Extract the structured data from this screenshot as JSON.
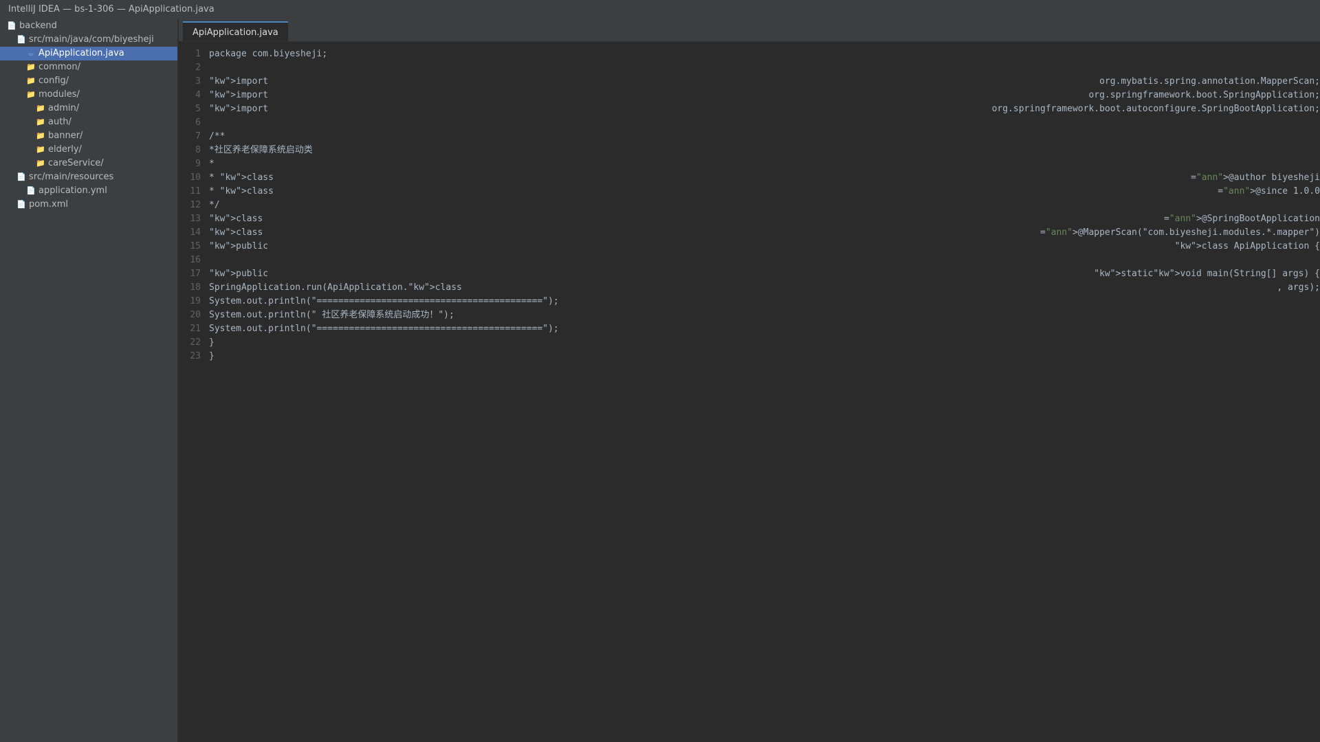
{
  "window": {
    "title": "IntelliJ IDEA — bs-1-306 — ApiApplication.java"
  },
  "sidebar": {
    "items": [
      {
        "label": "backend",
        "icon": "file-icon",
        "indent": 0
      },
      {
        "label": "src/main/java/com/biyesheji",
        "icon": "file-icon",
        "indent": 1
      },
      {
        "label": "ApiApplication.java",
        "icon": "java-file-icon",
        "indent": 2,
        "selected": true
      },
      {
        "label": "common/",
        "icon": "folder-icon",
        "indent": 2
      },
      {
        "label": "config/",
        "icon": "folder-icon",
        "indent": 2
      },
      {
        "label": "modules/",
        "icon": "folder-icon",
        "indent": 2
      },
      {
        "label": "admin/",
        "icon": "folder-icon",
        "indent": 3
      },
      {
        "label": "auth/",
        "icon": "folder-icon",
        "indent": 3
      },
      {
        "label": "banner/",
        "icon": "folder-icon",
        "indent": 3
      },
      {
        "label": "elderly/",
        "icon": "folder-icon",
        "indent": 3
      },
      {
        "label": "careService/",
        "icon": "folder-icon",
        "indent": 3
      },
      {
        "label": "src/main/resources",
        "icon": "file-icon",
        "indent": 1
      },
      {
        "label": "application.yml",
        "icon": "file-icon",
        "indent": 2
      },
      {
        "label": "pom.xml",
        "icon": "file-icon",
        "indent": 1
      }
    ]
  },
  "tabs": [
    {
      "label": "ApiApplication.java",
      "active": true
    }
  ],
  "editor": {
    "lines": [
      {
        "n": "1",
        "left": "package com.biyesheji;",
        "right": ""
      },
      {
        "n": "2",
        "left": "",
        "right": ""
      },
      {
        "n": "3",
        "left": "\"kw\">import",
        "right": "org.mybatis.spring.annotation.MapperScan;"
      },
      {
        "n": "4",
        "left": "\"kw\">import",
        "right": "org.springframework.boot.SpringApplication;"
      },
      {
        "n": "5",
        "left": "\"kw\">import",
        "right": "org.springframework.boot.autoconfigure.SpringBootApplication;"
      },
      {
        "n": "6",
        "left": "",
        "right": ""
      },
      {
        "n": "7",
        "left": "/**",
        "right": ""
      },
      {
        "n": "8",
        "left": "*社区养老保障系统启动类",
        "right": ""
      },
      {
        "n": "9",
        "left": "*",
        "right": ""
      },
      {
        "n": "10",
        "left": "* \"kw\">class",
        "right": "=\"ann\">@author biyesheji"
      },
      {
        "n": "11",
        "left": "* \"kw\">class",
        "right": "=\"ann\">@since 1.0.0"
      },
      {
        "n": "12",
        "left": "*/",
        "right": ""
      },
      {
        "n": "13",
        "left": "\"kw\">class",
        "right": "=\"ann\">@SpringBootApplication"
      },
      {
        "n": "14",
        "left": "\"kw\">class",
        "right": "=\"ann\">@MapperScan(\"com.biyesheji.modules.*.mapper\")"
      },
      {
        "n": "15",
        "left": "\"kw\">public",
        "right": "\"kw\">class ApiApplication {"
      },
      {
        "n": "16",
        "left": "",
        "right": ""
      },
      {
        "n": "17",
        "left": "\"kw\">public",
        "right": "\"kw\">static\"kw\">void main(String[] args) {"
      },
      {
        "n": "18",
        "left": "SpringApplication.run(ApiApplication.\"kw\">class",
        "right": ", args);"
      },
      {
        "n": "19",
        "left": "System.out.println(\"==========================================\");",
        "right": ""
      },
      {
        "n": "20",
        "left": "System.out.println(\" 社区养老保障系统启动成功！\");",
        "right": ""
      },
      {
        "n": "21",
        "left": "System.out.println(\"==========================================\");",
        "right": ""
      },
      {
        "n": "22",
        "left": "}",
        "right": ""
      },
      {
        "n": "23",
        "left": "}",
        "right": ""
      }
    ]
  },
  "colors": {
    "background": "#2b2b2b",
    "sidebar": "#3c3f41",
    "selection": "#4b6eaf",
    "text": "#a9b7c6",
    "line_number": "#606366",
    "string_green": "#6a8759"
  }
}
